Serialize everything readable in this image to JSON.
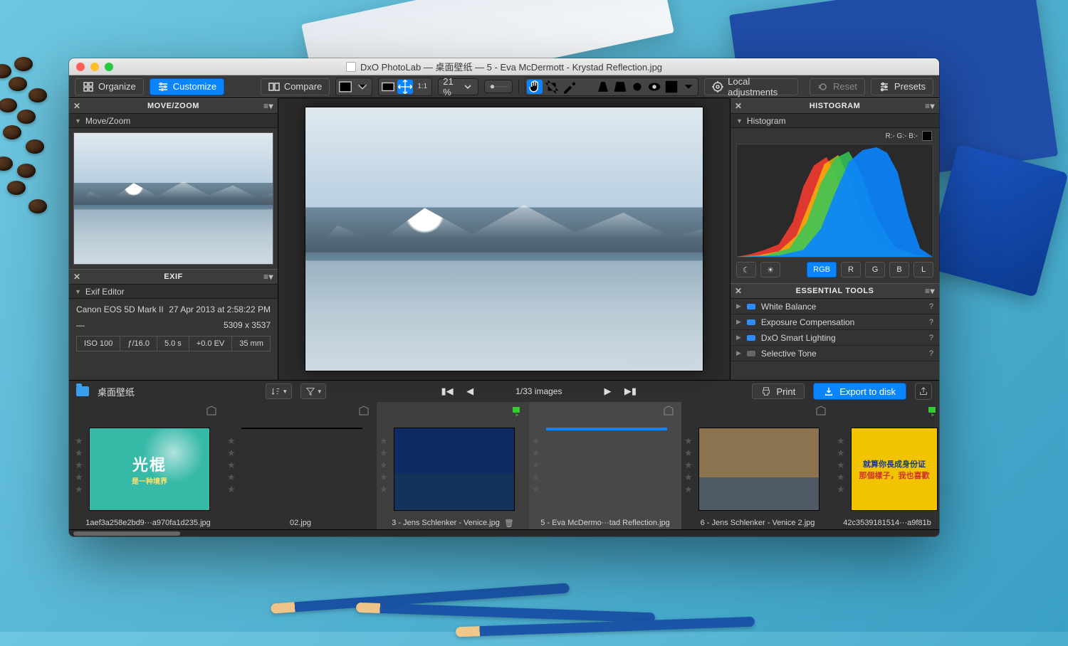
{
  "window": {
    "title": "DxO PhotoLab — 桌面壁纸 — 5 - Eva McDermott - Krystad Reflection.jpg"
  },
  "toolbar": {
    "organize": "Organize",
    "customize": "Customize",
    "compare": "Compare",
    "zoom_pct": "21 %",
    "zoom_11": "1:1",
    "local_adjustments": "Local adjustments",
    "reset": "Reset",
    "presets": "Presets"
  },
  "left": {
    "movezoom": {
      "header": "MOVE/ZOOM",
      "sub": "Move/Zoom"
    },
    "exif": {
      "header": "EXIF",
      "sub": "Exif Editor",
      "camera": "Canon EOS 5D Mark II",
      "datetime": "27 Apr 2013 at 2:58:22 PM",
      "lens": "—",
      "dimensions": "5309 x 3537",
      "chips": [
        "ISO 100",
        "ƒ/16.0",
        "5.0 s",
        "+0.0 EV",
        "35 mm"
      ]
    }
  },
  "center": {
    "credit": "© EVA McDERMOTT"
  },
  "right": {
    "hist": {
      "header": "HISTOGRAM",
      "sub": "Histogram",
      "readout": "R:- G:- B:-",
      "channels": [
        "RGB",
        "R",
        "G",
        "B",
        "L"
      ],
      "active_channel": "RGB"
    },
    "essential": {
      "header": "ESSENTIAL TOOLS",
      "items": [
        {
          "label": "White Balance",
          "color": "#2e8cff"
        },
        {
          "label": "Exposure Compensation",
          "color": "#2e8cff"
        },
        {
          "label": "DxO Smart Lighting",
          "color": "#2e8cff"
        },
        {
          "label": "Selective Tone",
          "color": "#666666"
        }
      ]
    }
  },
  "filmstrip": {
    "folder": "桌面壁纸",
    "counter": "1/33 images",
    "print": "Print",
    "export": "Export to disk",
    "thumbs": [
      {
        "label": "1aef3a258e2bd9···a970fa1d235.jpg",
        "overlay1": "光棍",
        "overlay2": "是一种境界"
      },
      {
        "label": "02.jpg"
      },
      {
        "label": "3 - Jens Schlenker - Venice.jpg",
        "trash": true,
        "badge": "green"
      },
      {
        "label": "5 - Eva McDermo···tad Reflection.jpg",
        "focused": true
      },
      {
        "label": "6 - Jens Schlenker - Venice 2.jpg"
      },
      {
        "label": "42c3539181514···a9f81b",
        "overlay3a": "就算你長成身份证",
        "overlay3b": "那個樣子，我也喜歡",
        "badge": "green"
      }
    ]
  }
}
